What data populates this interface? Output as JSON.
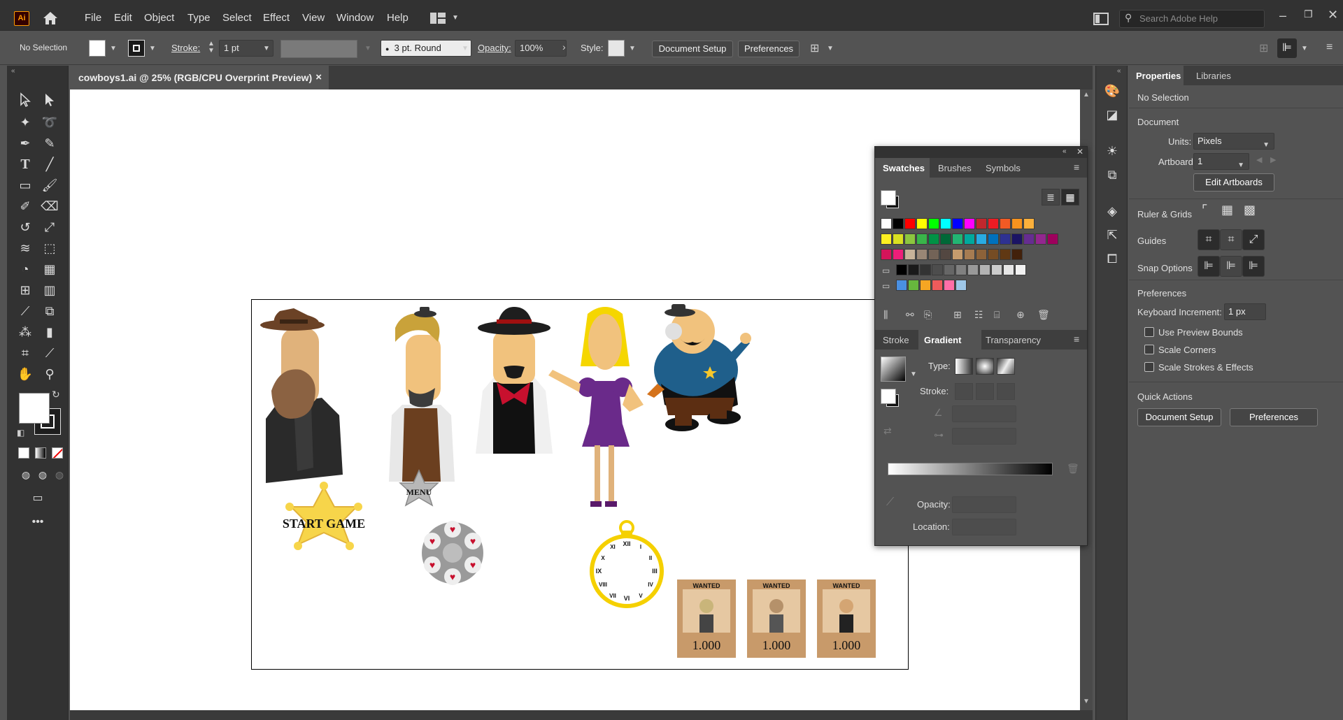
{
  "menubar": {
    "logo": "Ai",
    "menus": [
      "File",
      "Edit",
      "Object",
      "Type",
      "Select",
      "Effect",
      "View",
      "Window",
      "Help"
    ],
    "search_placeholder": "Search Adobe Help"
  },
  "controlbar": {
    "selection": "No Selection",
    "stroke_label": "Stroke:",
    "stroke_weight": "1 pt",
    "brush": "3 pt. Round",
    "opacity_label": "Opacity:",
    "opacity_value": "100%",
    "style_label": "Style:",
    "document_setup": "Document Setup",
    "preferences": "Preferences"
  },
  "document": {
    "tab_title": "cowboys1.ai @ 25% (RGB/CPU Overprint Preview)",
    "close": "×"
  },
  "artwork": {
    "start_game": "START GAME",
    "menu": "MENU",
    "wanted": "WANTED",
    "reward": "1.000",
    "clock_numerals": [
      "XII",
      "III",
      "VI",
      "IX",
      "XI",
      "I",
      "II",
      "IV",
      "V",
      "VII",
      "VIII",
      "X"
    ]
  },
  "swatches_panel": {
    "tabs": [
      "Swatches",
      "Brushes",
      "Symbols"
    ],
    "active_tab": "Swatches",
    "swatch_colors": [
      [
        "#ffffff",
        "#000000",
        "#ff0000",
        "#ffff00",
        "#00ff00",
        "#00ffff",
        "#0000ff",
        "#ff00ff",
        "#c1272d",
        "#ed1c24",
        "#f15a24",
        "#f7931e",
        "#fbb03b"
      ],
      [
        "#fcee21",
        "#d9e021",
        "#8cc63f",
        "#39b54a",
        "#009245",
        "#006837",
        "#22b573",
        "#00a99d",
        "#29abe2",
        "#0071bc",
        "#2e3192",
        "#1b1464",
        "#662d91",
        "#93278f",
        "#9e005d"
      ],
      [
        "#d4145a",
        "#ed1e79",
        "#c7b299",
        "#998675",
        "#736357",
        "#534741",
        "#c69c6d",
        "#a67c52",
        "#8c6239",
        "#754c24",
        "#603813",
        "#42210b"
      ],
      [
        "#000000",
        "#1a1a1a",
        "#333333",
        "#4d4d4d",
        "#666666",
        "#808080",
        "#999999",
        "#b3b3b3",
        "#cccccc",
        "#e6e6e6",
        "#f2f2f2"
      ],
      [
        "#4a90e2",
        "#67b73d",
        "#f5a623",
        "#ee5b5b",
        "#ff6fa8",
        "#9ec7e8"
      ]
    ]
  },
  "gradient_panel": {
    "tabs": [
      "Stroke",
      "Gradient",
      "Transparency"
    ],
    "active_tab": "Gradient",
    "type_label": "Type:",
    "stroke_label": "Stroke:",
    "opacity_label": "Opacity:",
    "location_label": "Location:"
  },
  "properties": {
    "tabs": [
      "Properties",
      "Libraries"
    ],
    "active_tab": "Properties",
    "selection": "No Selection",
    "document_heading": "Document",
    "units_label": "Units:",
    "units_value": "Pixels",
    "artboard_label": "Artboard:",
    "artboard_value": "1",
    "edit_artboards": "Edit Artboards",
    "ruler_grids": "Ruler & Grids",
    "guides": "Guides",
    "snap_options": "Snap Options",
    "preferences_heading": "Preferences",
    "keyboard_increment_label": "Keyboard Increment:",
    "keyboard_increment_value": "1 px",
    "use_preview_bounds": "Use Preview Bounds",
    "scale_corners": "Scale Corners",
    "scale_strokes": "Scale Strokes & Effects",
    "quick_actions": "Quick Actions",
    "document_setup": "Document Setup",
    "preferences": "Preferences"
  }
}
